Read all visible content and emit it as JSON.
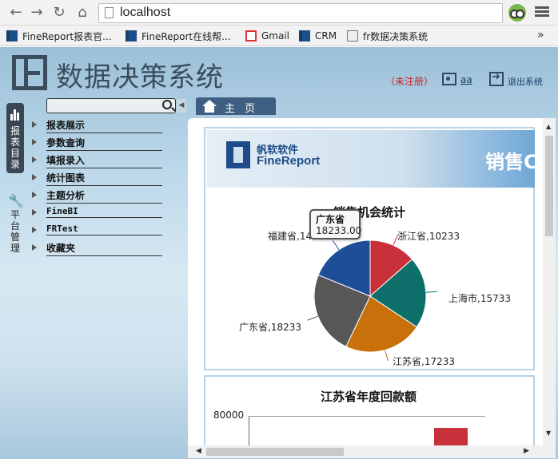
{
  "browser": {
    "url": "localhost",
    "bookmarks": [
      {
        "label": "FineReport报表官...",
        "icon": "finereport-favicon"
      },
      {
        "label": "FineReport在线帮...",
        "icon": "finereport-favicon"
      },
      {
        "label": "Gmail",
        "icon": "gmail-favicon"
      },
      {
        "label": "CRM",
        "icon": "finereport-favicon"
      },
      {
        "label": "fr数据决策系统",
        "icon": "page-favicon"
      }
    ],
    "more": "»"
  },
  "header": {
    "title": "数据决策系统",
    "unregistered": "（未注册）",
    "user": "aa",
    "logout": "退出系统"
  },
  "sidetabs": {
    "reports": "报表目录",
    "platform": "平台管理"
  },
  "tree": {
    "items": [
      {
        "label": "报表展示"
      },
      {
        "label": "参数查询"
      },
      {
        "label": "填报录入"
      },
      {
        "label": "统计图表"
      },
      {
        "label": "主题分析"
      },
      {
        "label": "FineBI"
      },
      {
        "label": "FRTest"
      },
      {
        "label": "收藏夹"
      }
    ]
  },
  "home_tab": {
    "label": "主页"
  },
  "banner": {
    "cn": "帆软软件",
    "en": "FineReport",
    "right": "销售C"
  },
  "colors": {
    "zhejiang": "#c8313a",
    "shanghai": "#0e6e6a",
    "jiangsu": "#c8700a",
    "guangdong": "#575757",
    "fujian": "#1f4e98"
  },
  "chart_data": [
    {
      "type": "pie",
      "title": "销售机会统计",
      "series": [
        {
          "name": "浙江省",
          "value": 10233,
          "label": "浙江省,10233"
        },
        {
          "name": "上海市",
          "value": 15733,
          "label": "上海市,15733"
        },
        {
          "name": "江苏省",
          "value": 17233,
          "label": "江苏省,17233"
        },
        {
          "name": "广东省",
          "value": 18233,
          "label": "广东省,18233"
        },
        {
          "name": "福建省",
          "value": 14233,
          "label": "福建省,14233"
        }
      ],
      "tooltip": {
        "name": "广东省",
        "value": "18233.00"
      }
    },
    {
      "type": "bar",
      "title": "江苏省年度回款额",
      "ytick_top": "80000"
    }
  ]
}
